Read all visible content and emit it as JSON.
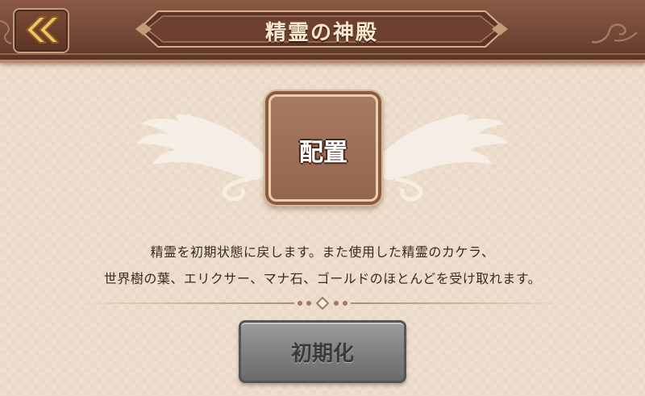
{
  "header": {
    "title": "精霊の神殿",
    "back_icon": "double-chevron-left-icon"
  },
  "main": {
    "place_button_label": "配置",
    "description_line1": "精霊を初期状態に戻します。また使用した精霊のカケラ、",
    "description_line2": "世界樹の葉、エリクサー、マナ石、ゴールドのほとんどを受け取れます。",
    "reset_button_label": "初期化",
    "reset_button_state": "disabled"
  },
  "colors": {
    "header_brown": "#6e4433",
    "background_beige": "#e9d9c6",
    "back_chevron_gold": "#f2c56a",
    "place_button_fill": "#a77a64",
    "reset_button_gray": "#8a8a8a"
  }
}
